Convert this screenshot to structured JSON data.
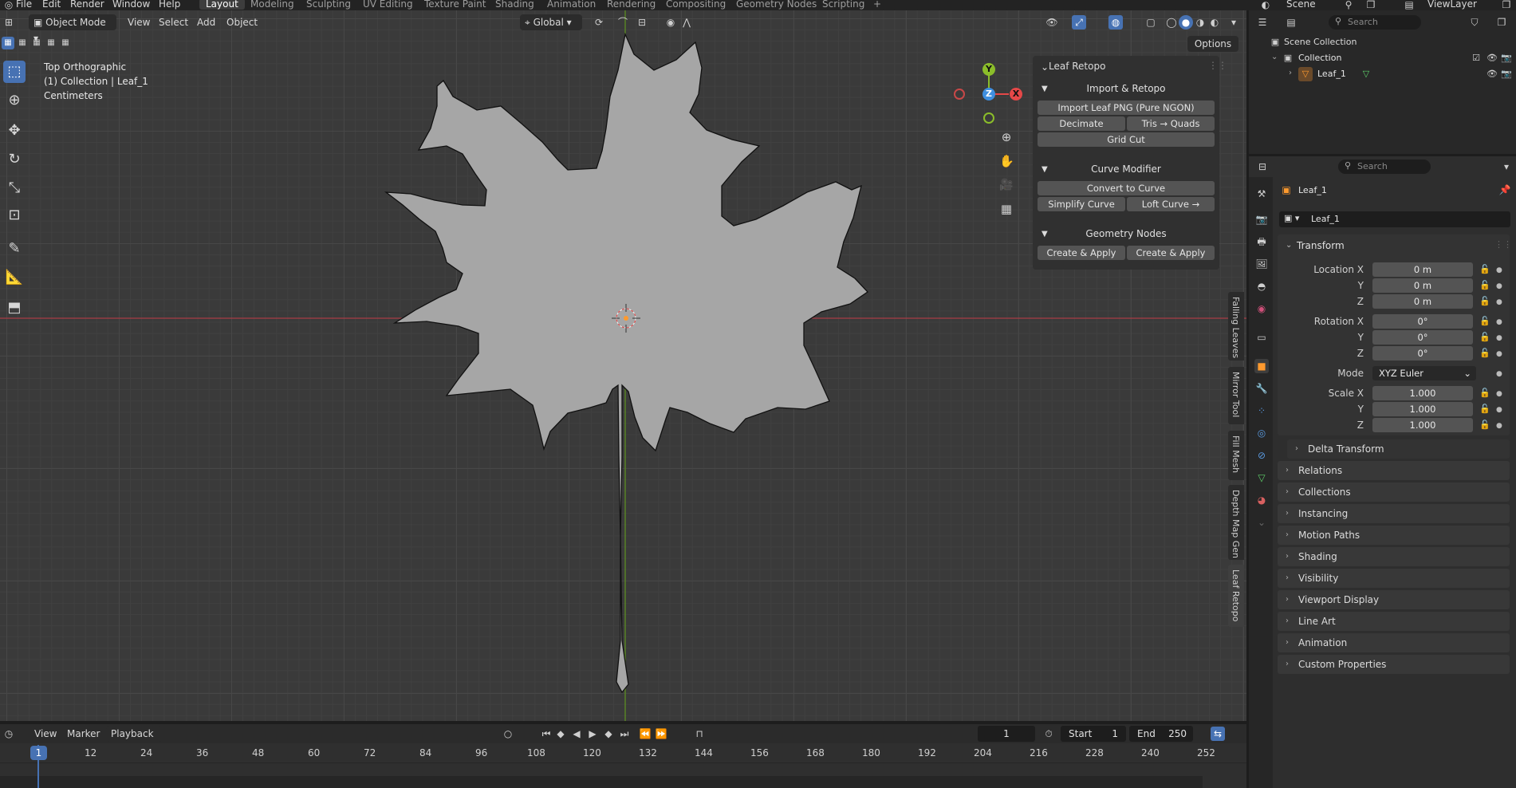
{
  "colors": {
    "accent": "#4772b3",
    "x_axis": "#e54848",
    "y_axis": "#8bbd2a",
    "z_axis": "#3f8fe0",
    "object_orange": "#ff9a2e"
  },
  "top_menu": [
    "File",
    "Edit",
    "Render",
    "Window",
    "Help"
  ],
  "workspaces": [
    "Layout",
    "Modeling",
    "Sculpting",
    "UV Editing",
    "Texture Paint",
    "Shading",
    "Animation",
    "Rendering",
    "Compositing",
    "Geometry Nodes",
    "Scripting"
  ],
  "active_workspace": "Layout",
  "scene": "Scene",
  "view_layer": "ViewLayer",
  "viewport_header": {
    "mode": "Object Mode",
    "menus": [
      "View",
      "Select",
      "Add",
      "Object"
    ],
    "orientation": "Global",
    "options": "Options"
  },
  "viewport_info": {
    "view": "Top Orthographic",
    "collection": "(1) Collection | Leaf_1",
    "units": "Centimeters"
  },
  "gizmo": {
    "y": "Y",
    "z": "Z",
    "x": "X"
  },
  "npanel": {
    "title": "Leaf Retopo",
    "sections": [
      {
        "title": "Import & Retopo",
        "buttons": [
          [
            "Import Leaf PNG (Pure NGON)"
          ],
          [
            "Decimate",
            "Tris → Quads"
          ],
          [
            "Grid Cut"
          ]
        ]
      },
      {
        "title": "Curve Modifier",
        "buttons": [
          [
            "Convert to Curve"
          ],
          [
            "Simplify Curve",
            "Loft Curve → Qua..."
          ]
        ]
      },
      {
        "title": "Geometry Nodes",
        "buttons": [
          [
            "Create & Apply Bend",
            "Create & Apply Su..."
          ]
        ]
      }
    ],
    "tabs": [
      "Falling Leaves",
      "Mirror Tool",
      "Fill Mesh",
      "Depth Map Gen",
      "Leaf Retopo"
    ]
  },
  "timeline": {
    "menus": [
      "View",
      "Marker",
      "Playback"
    ],
    "current_frame": "1",
    "start_label": "Start",
    "start": "1",
    "end_label": "End",
    "end": "250",
    "ticks": [
      "1",
      "12",
      "24",
      "36",
      "48",
      "60",
      "72",
      "84",
      "96",
      "108",
      "120",
      "132",
      "144",
      "156",
      "168",
      "180",
      "192",
      "204",
      "216",
      "228",
      "240",
      "252"
    ]
  },
  "outliner": {
    "search_placeholder": "Search",
    "root": "Scene Collection",
    "collection": "Collection",
    "object": "Leaf_1"
  },
  "properties": {
    "search_placeholder": "Search",
    "object_name": "Leaf_1",
    "object_field": "Leaf_1",
    "transform_title": "Transform",
    "location_label": "Location X",
    "location": [
      "0 m",
      "0 m",
      "0 m"
    ],
    "rotation_label": "Rotation X",
    "rotation": [
      "0°",
      "0°",
      "0°"
    ],
    "mode_label": "Mode",
    "mode": "XYZ Euler",
    "scale_label": "Scale X",
    "scale": [
      "1.000",
      "1.000",
      "1.000"
    ],
    "axis_y": "Y",
    "axis_z": "Z",
    "delta": "Delta Transform",
    "panels": [
      "Relations",
      "Collections",
      "Instancing",
      "Motion Paths",
      "Shading",
      "Visibility",
      "Viewport Display",
      "Line Art",
      "Animation",
      "Custom Properties"
    ]
  }
}
